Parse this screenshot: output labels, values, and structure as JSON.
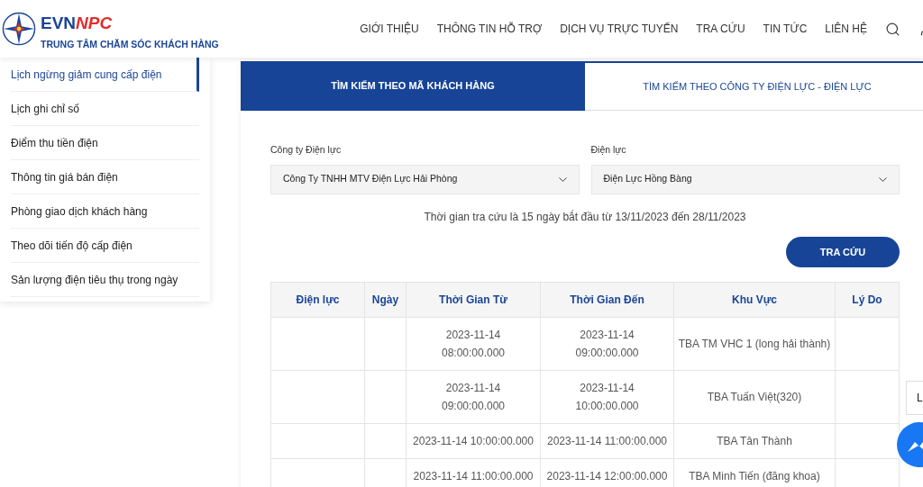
{
  "brand": {
    "name_a": "EVN",
    "name_b": "NPC",
    "subtitle": "TRUNG TÂM CHĂM SÓC KHÁCH HÀNG"
  },
  "nav": [
    "GIỚI THIỆU",
    "THÔNG TIN HỖ TRỢ",
    "DỊCH VỤ TRỰC TUYẾN",
    "TRA CỨU",
    "TIN TỨC",
    "LIÊN HỆ"
  ],
  "sidebar": {
    "items": [
      {
        "label": "Lịch ngừng giảm cung cấp điện",
        "selected": true
      },
      {
        "label": "Lịch ghi chỉ số",
        "selected": false
      },
      {
        "label": "Điểm thu tiền điện",
        "selected": false
      },
      {
        "label": "Thông tin giá bán điện",
        "selected": false
      },
      {
        "label": "Phòng giao dịch khách hàng",
        "selected": false
      },
      {
        "label": "Theo dõi tiến độ cấp điện",
        "selected": false
      },
      {
        "label": "Sản lượng điện tiêu thụ trong ngày",
        "selected": false
      }
    ]
  },
  "tabs": [
    {
      "label": "TÌM KIẾM THEO MÃ KHÁCH HÀNG",
      "selected": true
    },
    {
      "label": "TÌM KIẾM THEO CÔNG TY ĐIỆN LỰC - ĐIỆN LỰC",
      "selected": false
    }
  ],
  "form": {
    "fields": [
      {
        "label": "Công ty Điện lực",
        "value": "Công Ty TNHH MTV Điện Lực Hải Phòng"
      },
      {
        "label": "Điện lực",
        "value": "Điện Lực Hồng Bàng"
      }
    ],
    "note": "Thời gian tra cứu là 15 ngày bắt đầu từ 13/11/2023 đến 28/11/2023",
    "button": "TRA CỨU"
  },
  "table": {
    "columns": [
      "Điện lực",
      "Ngày",
      "Thời Gian Từ",
      "Thời Gian Đến",
      "Khu Vực",
      "Lý Do"
    ],
    "rows": [
      [
        [],
        [],
        [
          "2023-11-14",
          "08:00:00.000"
        ],
        [
          "2023-11-14",
          "09:00:00.000"
        ],
        [
          "TBA TM VHC 1 (long hải thành)"
        ],
        []
      ],
      [
        [],
        [],
        [
          "2023-11-14",
          "09:00:00.000"
        ],
        [
          "2023-11-14",
          "10:00:00.000"
        ],
        [
          "TBA Tuấn Việt(320)"
        ],
        []
      ],
      [
        [],
        [],
        [
          "2023-11-14 10:00:00.000"
        ],
        [
          "2023-11-14 11:00:00.000"
        ],
        [
          "TBA Tân Thành"
        ],
        []
      ],
      [
        [],
        [],
        [
          "2023-11-14 11:00:00.000"
        ],
        [
          "2023-11-14 12:00:00.000"
        ],
        [
          "TBA Minh Tiến (đăng khoa)"
        ],
        []
      ]
    ]
  },
  "side_tab": {
    "label": "L"
  }
}
